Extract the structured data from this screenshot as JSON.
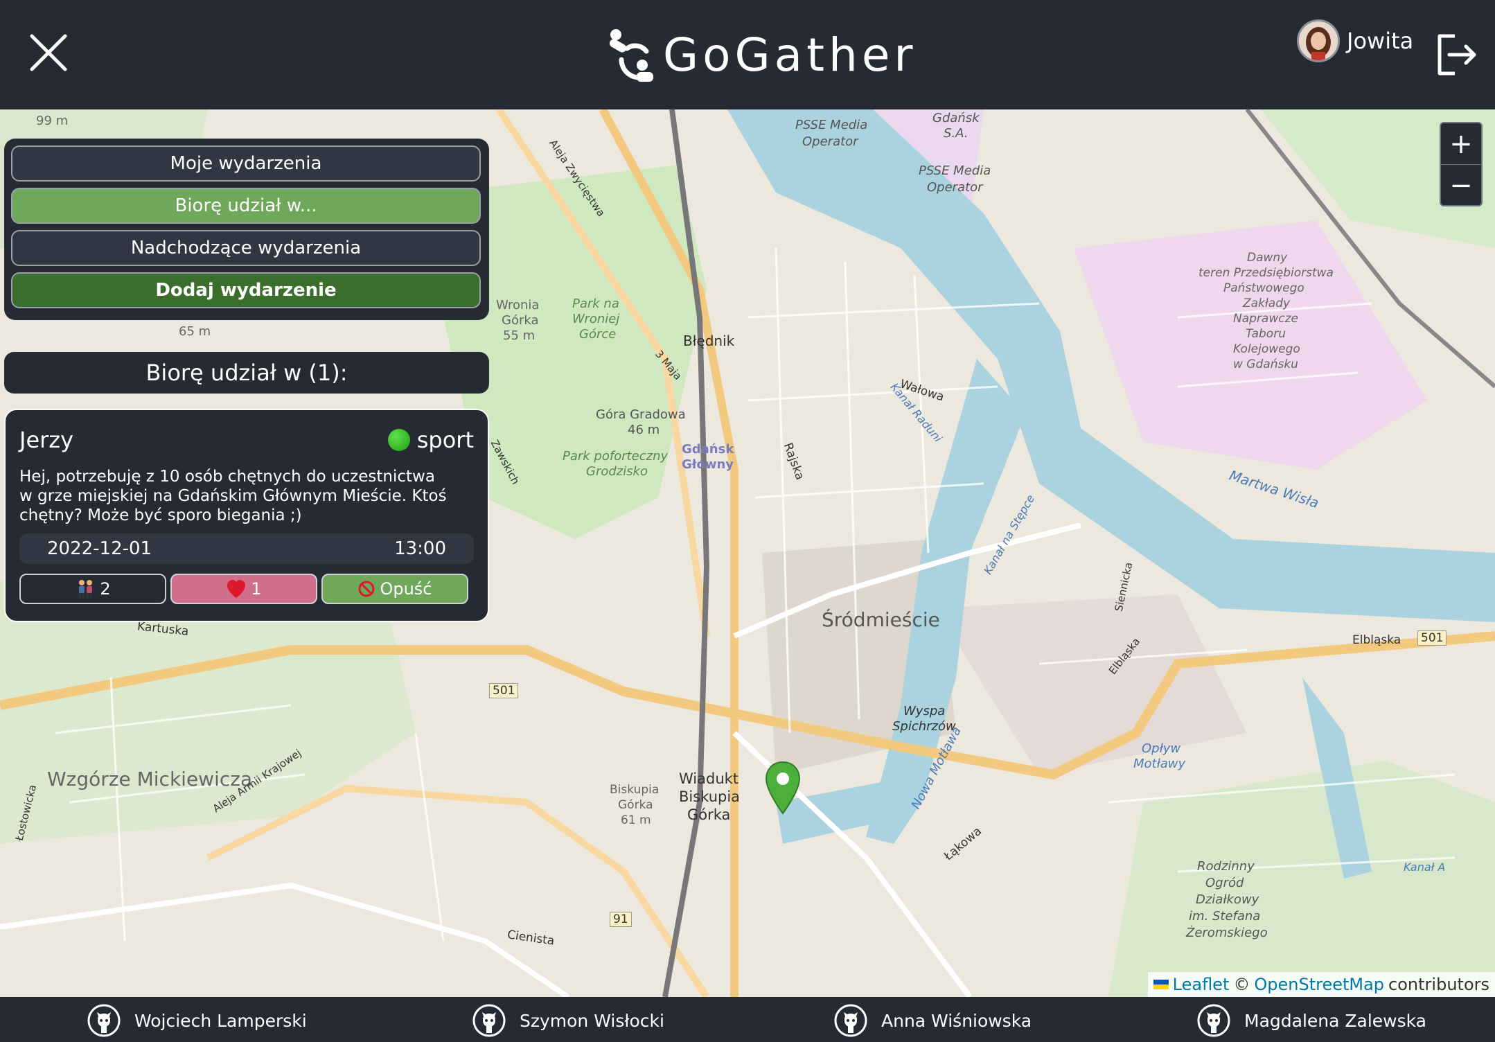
{
  "app": {
    "name": "GoGather"
  },
  "user": {
    "name": "Jowita"
  },
  "menu": {
    "my_events": "Moje wydarzenia",
    "participating": "Biorę udział w...",
    "upcoming": "Nadchodzące wydarzenia",
    "add_event": "Dodaj wydarzenie"
  },
  "section": {
    "title": "Biorę udział w (1):"
  },
  "event": {
    "author": "Jerzy",
    "category": "sport",
    "description": "Hej, potrzebuję z 10 osób chętnych do uczestnictwa w grze miejskiej na Gdańskim Głównym Mieście. Ktoś chętny? Może być sporo biegania ;)",
    "date": "2022-12-01",
    "time": "13:00",
    "participants": "2",
    "likes": "1",
    "leave_label": "Opuść"
  },
  "map": {
    "zoom_in": "+",
    "zoom_out": "−",
    "attribution_leaflet": "Leaflet",
    "attribution_osm": "OpenStreetMap",
    "attribution_suffix": "contributors",
    "attribution_sep": "©",
    "labels": {
      "srodmiescie": "Śródmieście",
      "wzgorze": "Wzgórze Mickiewicza",
      "blednik": "Błędnik",
      "gdansk_glowny": "Gdańsk Główny",
      "gora_gradowa": "Góra Gradowa",
      "gora_gradowa_h": "46 m",
      "park_forteczny": "Park poforteczny",
      "grodzisko": "Grodzisko",
      "wyspa": "Wyspa",
      "spichrzow": "Spichrzów",
      "wiadukt": "Wiadukt",
      "biskupia": "Biskupia",
      "gorka": "Górka",
      "martwa_wisla": "Martwa Wisła",
      "kartuska": "Kartuska",
      "road_501_a": "501",
      "road_501_b": "501",
      "road_91": "91",
      "elblaska": "Elbląska",
      "rodzinny": "Rodzinny",
      "ogrod": "Ogród",
      "dzialkowy": "Działkowy",
      "im_stefana": "im. Stefana",
      "zeromskiego": "Żeromskiego",
      "psse1": "PSSE Media",
      "operator1": "Operator",
      "psse2": "PSSE Media",
      "operator2": "Operator",
      "gdansk_sa": "Gdańsk",
      "sa": "S.A.",
      "wronia": "Wronia",
      "wronia_gorka": "Górka",
      "wronia_h": "55 m",
      "h99": "99 m",
      "h65": "65 m",
      "alleja": "Aleja Zwycięstwa",
      "dawny": "Dawny",
      "teren": "teren Przedsiębiorstwa",
      "panstwowego": "Państwowego",
      "zaklady": "Zakłady",
      "naprawcze": "Naprawcze",
      "taboru": "Taboru",
      "kolejowego": "Kolejowego",
      "w_gdansku": "w Gdańsku",
      "walowa": "Wałowa",
      "rajska": "Rajska",
      "cienista": "Cienista",
      "lakowa": "Łąkowa",
      "nowa_motlawa": "Nowa Motława",
      "oplyw": "Opływ",
      "motlawy": "Motławy",
      "armii": "Aleja Armii Krajowej",
      "lostowicka": "Łostowicka",
      "trzeciego_maja": "3 Maja",
      "kanal_raduni": "Kanał Raduni",
      "kanal_na_stepce": "Kanał na Stępce",
      "siennicka": "Siennicka",
      "biskupia_gorka2": "Biskupia",
      "gorka2": "Górka",
      "h61": "61 m",
      "park_na": "Park na",
      "wroniej": "Wroniej",
      "gorce": "Górce",
      "zawskich": "Zawskich",
      "elblaska2": "Elbląska",
      "kanal_a": "Kanał A"
    }
  },
  "footer": {
    "authors": [
      "Wojciech Lamperski",
      "Szymon Wisłocki",
      "Anna Wiśniowska",
      "Magdalena Zalewska"
    ]
  },
  "colors": {
    "header_bg": "#252a33",
    "active_green": "#6fa85a",
    "add_green": "#3b6e2d",
    "like_pink": "#cf6f8c",
    "marker_green": "#4caf3c"
  }
}
